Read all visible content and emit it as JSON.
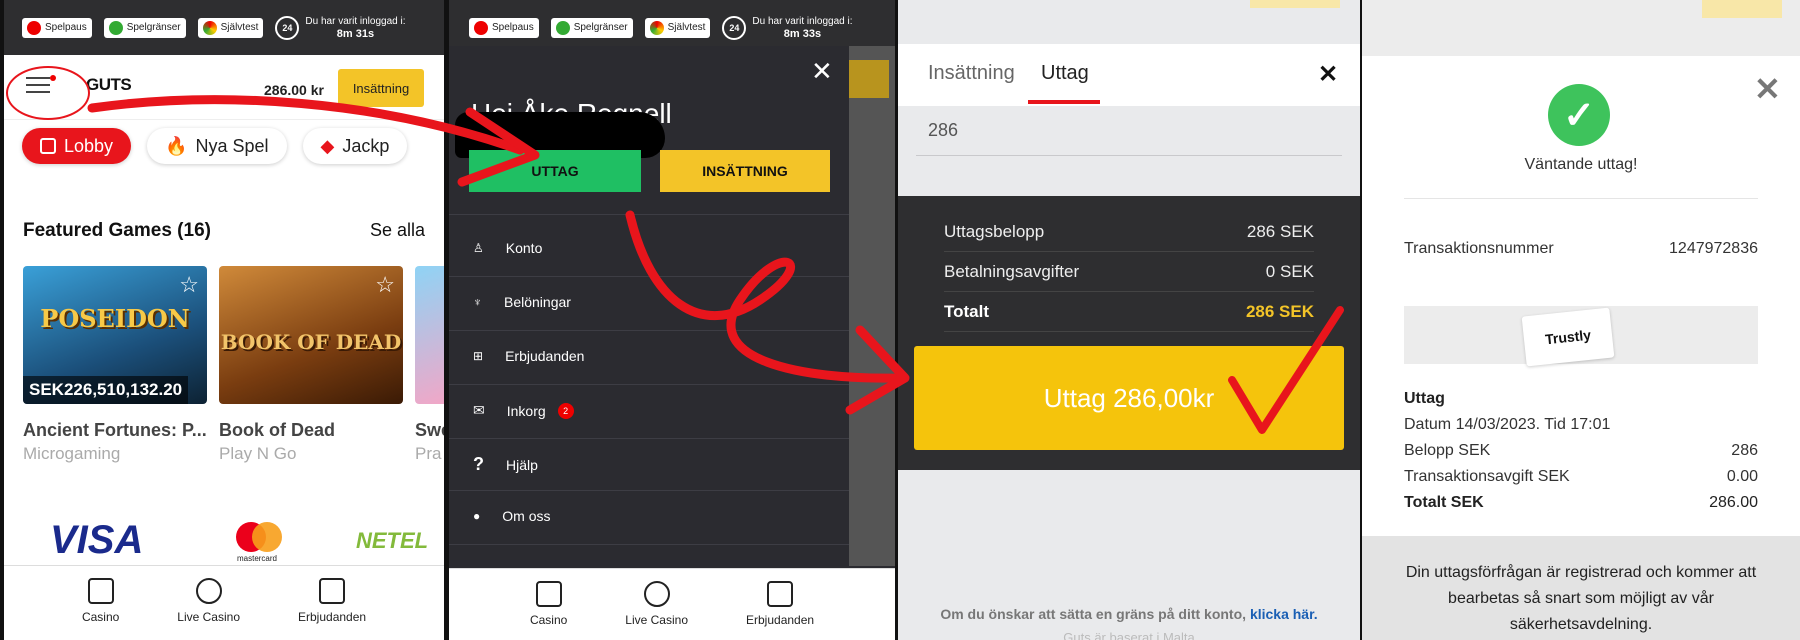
{
  "topbar": {
    "spelpaus": "Spelpaus",
    "spelgranser": "Spelgränser",
    "sjalvtest": "Självtest",
    "timer_badge": "24",
    "logged_in_label": "Du har varit inloggad i:",
    "time_p1": "8m 31s",
    "time_p2": "8m 33s"
  },
  "header": {
    "logo": "GUTS",
    "balance": "286.00 kr",
    "deposit": "Insättning"
  },
  "pills": [
    "Lobby",
    "Nya Spel",
    "Jackp"
  ],
  "featured": {
    "title": "Featured Games (16)",
    "see_all": "Se alla",
    "games": [
      {
        "name": "Ancient Fortunes: P...",
        "provider": "Microgaming",
        "jackpot": "SEK226,510,132.20",
        "art": "POSEIDON"
      },
      {
        "name": "Book of Dead",
        "provider": "Play N Go",
        "art": "BOOK OF DEAD"
      },
      {
        "name": "Swe",
        "provider": "Pra"
      }
    ]
  },
  "payments": [
    "VISA",
    "mastercard",
    "NETEL"
  ],
  "bottomnav": [
    "Casino",
    "Live Casino",
    "Erbjudanden"
  ],
  "menu": {
    "greeting": "Hej Åke Regnell",
    "withdraw": "UTTAG",
    "deposit": "INSÄTTNING",
    "items": [
      {
        "label": "Konto"
      },
      {
        "label": "Belöningar"
      },
      {
        "label": "Erbjudanden"
      },
      {
        "label": "Inkorg",
        "badge": "2"
      },
      {
        "label": "Hjälp"
      },
      {
        "label": "Om oss"
      }
    ]
  },
  "withdraw_form": {
    "tab_deposit": "Insättning",
    "tab_withdraw": "Uttag",
    "amount": "286",
    "rows": [
      {
        "label": "Uttagsbelopp",
        "value": "286 SEK"
      },
      {
        "label": "Betalningsavgifter",
        "value": "0 SEK"
      },
      {
        "label": "Totalt",
        "value": "286 SEK"
      }
    ],
    "submit": "Uttag 286,00kr",
    "limit_text": "Om du önskar att sätta en gräns på ditt konto,",
    "limit_link": "klicka här.",
    "based": "Guts är baserat i Malta"
  },
  "receipt": {
    "status": "Väntande uttag!",
    "txn_label": "Transaktionsnummer",
    "txn_value": "1247972836",
    "provider": "Trustly",
    "heading": "Uttag",
    "date": "Datum 14/03/2023. Tid 17:01",
    "rows": [
      {
        "label": "Belopp SEK",
        "value": "286"
      },
      {
        "label": "Transaktionsavgift SEK",
        "value": "0.00"
      },
      {
        "label": "Totalt SEK",
        "value": "286.00"
      }
    ],
    "message": "Din uttagsförfrågan är registrerad och kommer att bearbetas så snart som möjligt av vår säkerhetsavdelning."
  },
  "colors": {
    "accent_red": "#e8151c",
    "yellow": "#f3c428",
    "green": "#1fbf63",
    "dark": "#2b2b30"
  }
}
